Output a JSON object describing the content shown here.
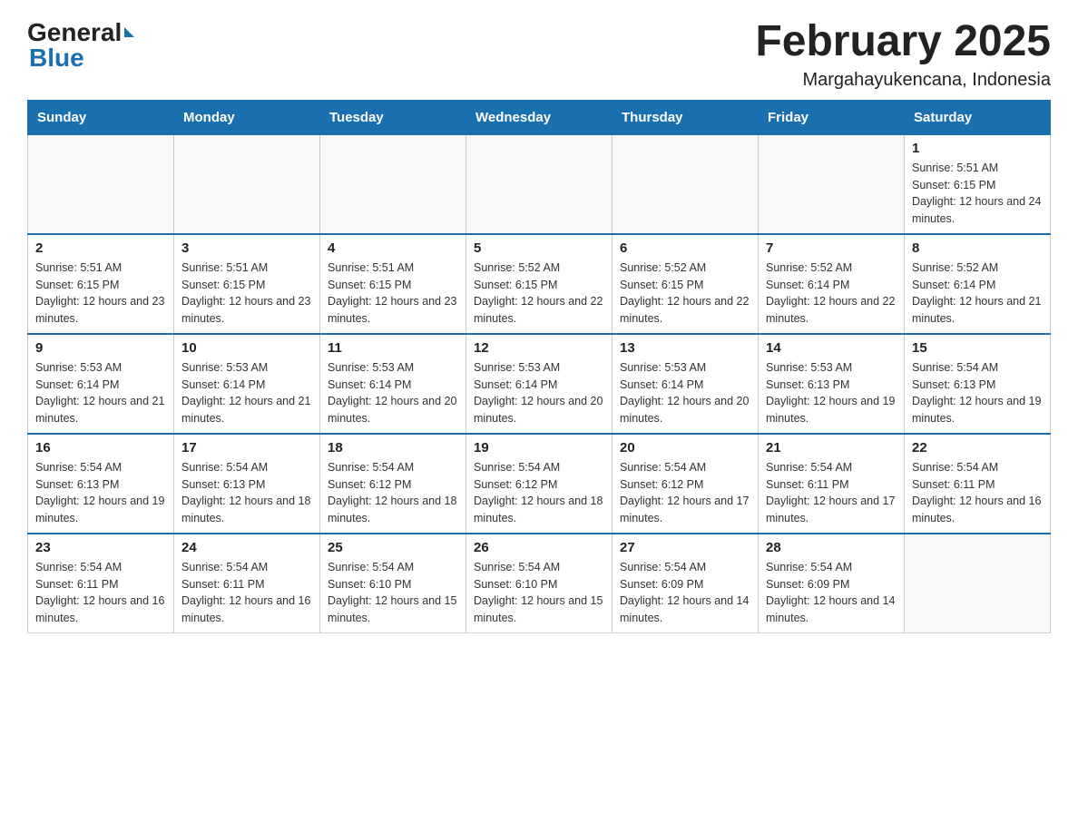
{
  "header": {
    "logo_general": "General",
    "logo_blue": "Blue",
    "month_title": "February 2025",
    "location": "Margahayukencana, Indonesia"
  },
  "weekdays": [
    "Sunday",
    "Monday",
    "Tuesday",
    "Wednesday",
    "Thursday",
    "Friday",
    "Saturday"
  ],
  "weeks": [
    [
      {
        "day": "",
        "sunrise": "",
        "sunset": "",
        "daylight": ""
      },
      {
        "day": "",
        "sunrise": "",
        "sunset": "",
        "daylight": ""
      },
      {
        "day": "",
        "sunrise": "",
        "sunset": "",
        "daylight": ""
      },
      {
        "day": "",
        "sunrise": "",
        "sunset": "",
        "daylight": ""
      },
      {
        "day": "",
        "sunrise": "",
        "sunset": "",
        "daylight": ""
      },
      {
        "day": "",
        "sunrise": "",
        "sunset": "",
        "daylight": ""
      },
      {
        "day": "1",
        "sunrise": "Sunrise: 5:51 AM",
        "sunset": "Sunset: 6:15 PM",
        "daylight": "Daylight: 12 hours and 24 minutes."
      }
    ],
    [
      {
        "day": "2",
        "sunrise": "Sunrise: 5:51 AM",
        "sunset": "Sunset: 6:15 PM",
        "daylight": "Daylight: 12 hours and 23 minutes."
      },
      {
        "day": "3",
        "sunrise": "Sunrise: 5:51 AM",
        "sunset": "Sunset: 6:15 PM",
        "daylight": "Daylight: 12 hours and 23 minutes."
      },
      {
        "day": "4",
        "sunrise": "Sunrise: 5:51 AM",
        "sunset": "Sunset: 6:15 PM",
        "daylight": "Daylight: 12 hours and 23 minutes."
      },
      {
        "day": "5",
        "sunrise": "Sunrise: 5:52 AM",
        "sunset": "Sunset: 6:15 PM",
        "daylight": "Daylight: 12 hours and 22 minutes."
      },
      {
        "day": "6",
        "sunrise": "Sunrise: 5:52 AM",
        "sunset": "Sunset: 6:15 PM",
        "daylight": "Daylight: 12 hours and 22 minutes."
      },
      {
        "day": "7",
        "sunrise": "Sunrise: 5:52 AM",
        "sunset": "Sunset: 6:14 PM",
        "daylight": "Daylight: 12 hours and 22 minutes."
      },
      {
        "day": "8",
        "sunrise": "Sunrise: 5:52 AM",
        "sunset": "Sunset: 6:14 PM",
        "daylight": "Daylight: 12 hours and 21 minutes."
      }
    ],
    [
      {
        "day": "9",
        "sunrise": "Sunrise: 5:53 AM",
        "sunset": "Sunset: 6:14 PM",
        "daylight": "Daylight: 12 hours and 21 minutes."
      },
      {
        "day": "10",
        "sunrise": "Sunrise: 5:53 AM",
        "sunset": "Sunset: 6:14 PM",
        "daylight": "Daylight: 12 hours and 21 minutes."
      },
      {
        "day": "11",
        "sunrise": "Sunrise: 5:53 AM",
        "sunset": "Sunset: 6:14 PM",
        "daylight": "Daylight: 12 hours and 20 minutes."
      },
      {
        "day": "12",
        "sunrise": "Sunrise: 5:53 AM",
        "sunset": "Sunset: 6:14 PM",
        "daylight": "Daylight: 12 hours and 20 minutes."
      },
      {
        "day": "13",
        "sunrise": "Sunrise: 5:53 AM",
        "sunset": "Sunset: 6:14 PM",
        "daylight": "Daylight: 12 hours and 20 minutes."
      },
      {
        "day": "14",
        "sunrise": "Sunrise: 5:53 AM",
        "sunset": "Sunset: 6:13 PM",
        "daylight": "Daylight: 12 hours and 19 minutes."
      },
      {
        "day": "15",
        "sunrise": "Sunrise: 5:54 AM",
        "sunset": "Sunset: 6:13 PM",
        "daylight": "Daylight: 12 hours and 19 minutes."
      }
    ],
    [
      {
        "day": "16",
        "sunrise": "Sunrise: 5:54 AM",
        "sunset": "Sunset: 6:13 PM",
        "daylight": "Daylight: 12 hours and 19 minutes."
      },
      {
        "day": "17",
        "sunrise": "Sunrise: 5:54 AM",
        "sunset": "Sunset: 6:13 PM",
        "daylight": "Daylight: 12 hours and 18 minutes."
      },
      {
        "day": "18",
        "sunrise": "Sunrise: 5:54 AM",
        "sunset": "Sunset: 6:12 PM",
        "daylight": "Daylight: 12 hours and 18 minutes."
      },
      {
        "day": "19",
        "sunrise": "Sunrise: 5:54 AM",
        "sunset": "Sunset: 6:12 PM",
        "daylight": "Daylight: 12 hours and 18 minutes."
      },
      {
        "day": "20",
        "sunrise": "Sunrise: 5:54 AM",
        "sunset": "Sunset: 6:12 PM",
        "daylight": "Daylight: 12 hours and 17 minutes."
      },
      {
        "day": "21",
        "sunrise": "Sunrise: 5:54 AM",
        "sunset": "Sunset: 6:11 PM",
        "daylight": "Daylight: 12 hours and 17 minutes."
      },
      {
        "day": "22",
        "sunrise": "Sunrise: 5:54 AM",
        "sunset": "Sunset: 6:11 PM",
        "daylight": "Daylight: 12 hours and 16 minutes."
      }
    ],
    [
      {
        "day": "23",
        "sunrise": "Sunrise: 5:54 AM",
        "sunset": "Sunset: 6:11 PM",
        "daylight": "Daylight: 12 hours and 16 minutes."
      },
      {
        "day": "24",
        "sunrise": "Sunrise: 5:54 AM",
        "sunset": "Sunset: 6:11 PM",
        "daylight": "Daylight: 12 hours and 16 minutes."
      },
      {
        "day": "25",
        "sunrise": "Sunrise: 5:54 AM",
        "sunset": "Sunset: 6:10 PM",
        "daylight": "Daylight: 12 hours and 15 minutes."
      },
      {
        "day": "26",
        "sunrise": "Sunrise: 5:54 AM",
        "sunset": "Sunset: 6:10 PM",
        "daylight": "Daylight: 12 hours and 15 minutes."
      },
      {
        "day": "27",
        "sunrise": "Sunrise: 5:54 AM",
        "sunset": "Sunset: 6:09 PM",
        "daylight": "Daylight: 12 hours and 14 minutes."
      },
      {
        "day": "28",
        "sunrise": "Sunrise: 5:54 AM",
        "sunset": "Sunset: 6:09 PM",
        "daylight": "Daylight: 12 hours and 14 minutes."
      },
      {
        "day": "",
        "sunrise": "",
        "sunset": "",
        "daylight": ""
      }
    ]
  ]
}
